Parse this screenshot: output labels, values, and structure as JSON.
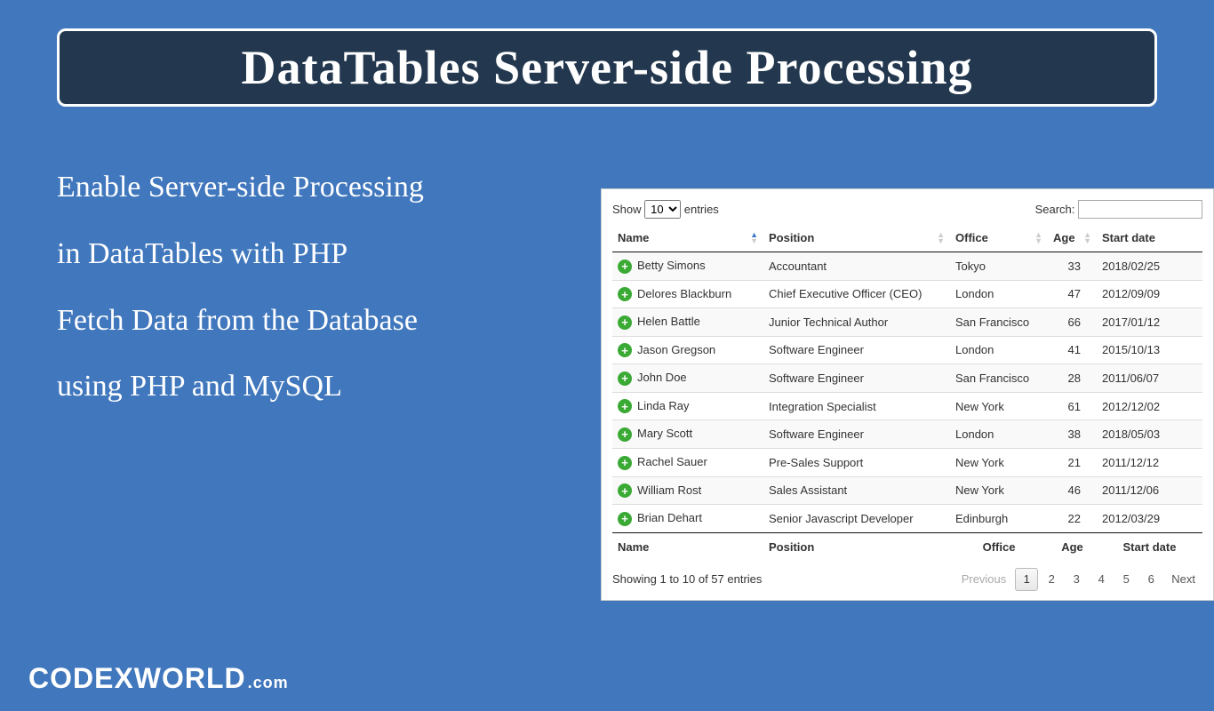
{
  "banner": {
    "title": "DataTables Server-side Processing"
  },
  "left": {
    "line1": "Enable Server-side Processing",
    "line2": "in DataTables with PHP",
    "line3": "Fetch Data from the Database",
    "line4": "using PHP and MySQL"
  },
  "table": {
    "length_show": "Show",
    "length_value": "10",
    "length_entries": "entries",
    "search_label": "Search:",
    "search_value": "",
    "columns": [
      "Name",
      "Position",
      "Office",
      "Age",
      "Start date"
    ],
    "footer_columns": [
      "Name",
      "Position",
      "Office",
      "Age",
      "Start date"
    ],
    "rows": [
      {
        "name": "Betty Simons",
        "position": "Accountant",
        "office": "Tokyo",
        "age": "33",
        "start": "2018/02/25"
      },
      {
        "name": "Delores Blackburn",
        "position": "Chief Executive Officer (CEO)",
        "office": "London",
        "age": "47",
        "start": "2012/09/09"
      },
      {
        "name": "Helen Battle",
        "position": "Junior Technical Author",
        "office": "San Francisco",
        "age": "66",
        "start": "2017/01/12"
      },
      {
        "name": "Jason Gregson",
        "position": "Software Engineer",
        "office": "London",
        "age": "41",
        "start": "2015/10/13"
      },
      {
        "name": "John Doe",
        "position": "Software Engineer",
        "office": "San Francisco",
        "age": "28",
        "start": "2011/06/07"
      },
      {
        "name": "Linda Ray",
        "position": "Integration Specialist",
        "office": "New York",
        "age": "61",
        "start": "2012/12/02"
      },
      {
        "name": "Mary Scott",
        "position": "Software Engineer",
        "office": "London",
        "age": "38",
        "start": "2018/05/03"
      },
      {
        "name": "Rachel Sauer",
        "position": "Pre-Sales Support",
        "office": "New York",
        "age": "21",
        "start": "2011/12/12"
      },
      {
        "name": "William Rost",
        "position": "Sales Assistant",
        "office": "New York",
        "age": "46",
        "start": "2011/12/06"
      },
      {
        "name": "Brian Dehart",
        "position": "Senior Javascript Developer",
        "office": "Edinburgh",
        "age": "22",
        "start": "2012/03/29"
      }
    ],
    "info": "Showing 1 to 10 of 57 entries",
    "pagination": {
      "previous": "Previous",
      "pages": [
        "1",
        "2",
        "3",
        "4",
        "5",
        "6"
      ],
      "active": "1",
      "next": "Next"
    }
  },
  "footer": {
    "brand": "CODEXWORLD",
    "tld": ".com"
  }
}
